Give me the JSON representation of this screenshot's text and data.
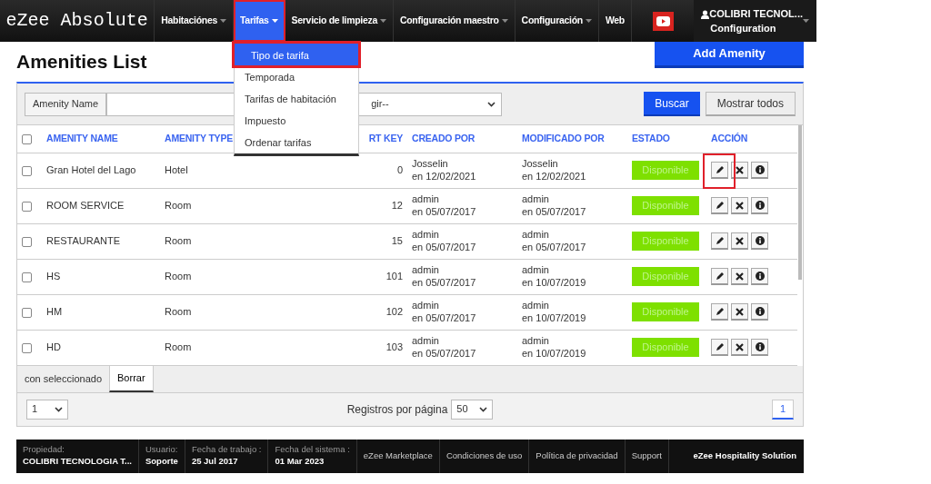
{
  "brand": "eZee Absolute",
  "nav": [
    {
      "label": "Habitaciónes",
      "dropdown": true,
      "selected": false,
      "highlighted": false
    },
    {
      "label": "Tarifas",
      "dropdown": true,
      "selected": true,
      "highlighted": true
    },
    {
      "label": "Servicio de limpieza",
      "dropdown": true,
      "selected": false,
      "highlighted": false
    },
    {
      "label": "Configuración maestro",
      "dropdown": true,
      "selected": false,
      "highlighted": false
    },
    {
      "label": "Configuración",
      "dropdown": true,
      "selected": false,
      "highlighted": false
    },
    {
      "label": "Web",
      "dropdown": false,
      "selected": false,
      "highlighted": false
    }
  ],
  "user": {
    "name": "COLIBRI TECNOL...",
    "role": "Configuration"
  },
  "dropdown_menu": [
    {
      "label": "Tipo de tarifa",
      "selected": true,
      "highlighted": true
    },
    {
      "label": "Temporada",
      "selected": false,
      "highlighted": false
    },
    {
      "label": "Tarifas de habitación",
      "selected": false,
      "highlighted": false
    },
    {
      "label": "Impuesto",
      "selected": false,
      "highlighted": false
    },
    {
      "label": "Ordenar tarifas",
      "selected": false,
      "highlighted": false
    }
  ],
  "page_title": "Amenities List",
  "add_button": "Add Amenity",
  "filter": {
    "label": "Amenity Name",
    "select_value": "gir--",
    "search_button": "Buscar",
    "show_all_button": "Mostrar todos"
  },
  "table": {
    "columns": [
      "AMENITY NAME",
      "AMENITY TYPE",
      "RT KEY",
      "CREADO POR",
      "MODIFICADO POR",
      "ESTADO",
      "ACCIÓN"
    ],
    "all_checked": false,
    "rows": [
      {
        "checked": false,
        "name": "Gran Hotel del Lago",
        "type": "Hotel",
        "sort_key": "0",
        "created_by": "Josselin",
        "created_on": "en 12/02/2021",
        "modified_by": "Josselin",
        "modified_on": "en 12/02/2021",
        "status": "Disponible",
        "edit_highlighted": true
      },
      {
        "checked": false,
        "name": "ROOM SERVICE",
        "type": "Room",
        "sort_key": "12",
        "created_by": "admin",
        "created_on": "en 05/07/2017",
        "modified_by": "admin",
        "modified_on": "en 05/07/2017",
        "status": "Disponible",
        "edit_highlighted": false
      },
      {
        "checked": false,
        "name": "RESTAURANTE",
        "type": "Room",
        "sort_key": "15",
        "created_by": "admin",
        "created_on": "en 05/07/2017",
        "modified_by": "admin",
        "modified_on": "en 05/07/2017",
        "status": "Disponible",
        "edit_highlighted": false
      },
      {
        "checked": false,
        "name": "HS",
        "type": "Room",
        "sort_key": "101",
        "created_by": "admin",
        "created_on": "en 05/07/2017",
        "modified_by": "admin",
        "modified_on": "en 10/07/2019",
        "status": "Disponible",
        "edit_highlighted": false
      },
      {
        "checked": false,
        "name": "HM",
        "type": "Room",
        "sort_key": "102",
        "created_by": "admin",
        "created_on": "en 05/07/2017",
        "modified_by": "admin",
        "modified_on": "en 10/07/2019",
        "status": "Disponible",
        "edit_highlighted": false
      },
      {
        "checked": false,
        "name": "HD",
        "type": "Room",
        "sort_key": "103",
        "created_by": "admin",
        "created_on": "en 05/07/2017",
        "modified_by": "admin",
        "modified_on": "en 10/07/2019",
        "status": "Disponible",
        "edit_highlighted": false
      }
    ]
  },
  "bulk": {
    "label": "con seleccionado",
    "delete_button": "Borrar"
  },
  "pagination": {
    "page_select": "1",
    "per_page_label": "Registros por página",
    "per_page": "50",
    "current_page": "1"
  },
  "footer": {
    "info": [
      {
        "label": "Propiedad:",
        "value": "COLIBRI TECNOLOGIA T..."
      },
      {
        "label": "Usuario:",
        "value": "Soporte"
      },
      {
        "label": "Fecha de trabajo :",
        "value": "25 Jul 2017"
      },
      {
        "label": "Fecha del sistema :",
        "value": "01 Mar 2023"
      }
    ],
    "links": [
      "eZee Marketplace",
      "Condiciones de uso",
      "Política de privacidad",
      "Support"
    ],
    "brand": "eZee Hospitality Solution"
  }
}
